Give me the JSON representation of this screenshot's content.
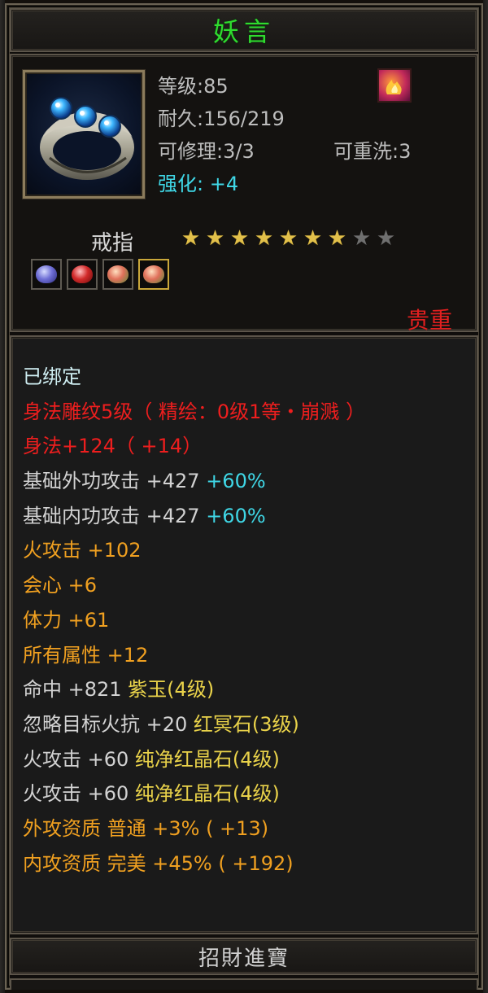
{
  "title": "妖言",
  "item": {
    "level": "等级:85",
    "durability": "耐久:156/219",
    "repairable": "可修理:3/3",
    "rewashable": "可重洗:3",
    "enhance_label": "强化: ",
    "enhance_value": "+4",
    "type": "戒指",
    "stars_total": 9,
    "stars_filled": 7,
    "rarity": "贵重",
    "icon": "silver-ring-with-blue-gems",
    "skill_icon": "fire-skill-icon",
    "gems": [
      "blue-gem",
      "red-gem",
      "peach-gem",
      "peach-gem"
    ]
  },
  "attributes": [
    {
      "color": "cyan",
      "parts": [
        "已绑定"
      ]
    },
    {
      "color": "red",
      "parts": [
        "身法雕纹5级（ 精绘：0级1等・崩溅 ）"
      ]
    },
    {
      "color": "red",
      "parts": [
        "身法+124（ +14）"
      ]
    },
    {
      "color": "white",
      "parts": [
        "基础外功攻击 +427 "
      ],
      "extra": "+60%",
      "extra_color": "teal"
    },
    {
      "color": "white",
      "parts": [
        "基础内功攻击 +427 "
      ],
      "extra": "+60%",
      "extra_color": "teal"
    },
    {
      "color": "orange",
      "parts": [
        "火攻击 +102"
      ]
    },
    {
      "color": "orange",
      "parts": [
        "会心 +6"
      ]
    },
    {
      "color": "orange",
      "parts": [
        "体力 +61"
      ]
    },
    {
      "color": "orange",
      "parts": [
        "所有属性 +12"
      ]
    },
    {
      "color": "white",
      "parts": [
        "命中 +821 "
      ],
      "extra": "紫玉(4级)",
      "extra_color": "yellow"
    },
    {
      "color": "white",
      "parts": [
        "忽略目标火抗 +20 "
      ],
      "extra": "红冥石(3级)",
      "extra_color": "yellow"
    },
    {
      "color": "white",
      "parts": [
        "火攻击 +60 "
      ],
      "extra": "纯净红晶石(4级)",
      "extra_color": "yellow"
    },
    {
      "color": "white",
      "parts": [
        "火攻击 +60 "
      ],
      "extra": "纯净红晶石(4级)",
      "extra_color": "yellow"
    },
    {
      "color": "orange",
      "parts": [
        "外攻资质  普通 +3% ( +13)"
      ]
    },
    {
      "color": "orange",
      "parts": [
        "内攻资质  完美 +45% ( +192)"
      ]
    }
  ],
  "footer": "招財進寶",
  "colors": {
    "title": "#2fdc2f",
    "rarity": "#e11f1f",
    "enhance": "#3fd7e6",
    "star_on": "#e2c04a",
    "star_off": "#6f6f6f"
  }
}
